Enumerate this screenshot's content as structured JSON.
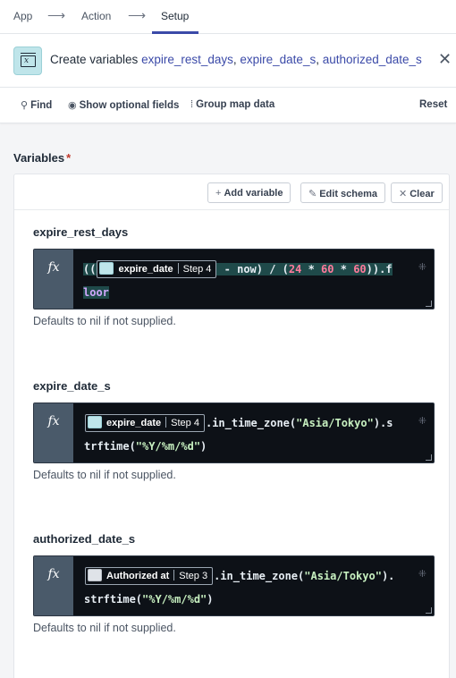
{
  "breadcrumb": {
    "steps": [
      {
        "label": "App"
      },
      {
        "label": "Action"
      },
      {
        "label": "Setup"
      }
    ],
    "active": "Setup"
  },
  "header": {
    "prefix": "Create variables ",
    "variables": [
      "expire_rest_days",
      "expire_date_s",
      "authorized_date_s"
    ],
    "separator": ", ",
    "close_icon": "close-icon"
  },
  "toolbar": {
    "find": "Find",
    "show_optional": "Show optional fields",
    "group_map": "Group map data",
    "reset": "Reset"
  },
  "section": {
    "label": "Variables",
    "required_mark": "*"
  },
  "panel_toolbar": {
    "add_variable": "Add variable",
    "edit_schema": "Edit schema",
    "clear": "Clear"
  },
  "fields": [
    {
      "name": "expire_rest_days",
      "fx": "fx",
      "pill": {
        "name": "expire_date",
        "step": "Step 4"
      },
      "code_pre": "((",
      "code_post": " - now) / (24 * 60 * 60)).f",
      "code_line2": "loor",
      "hint": "Defaults to nil if not supplied."
    },
    {
      "name": "expire_date_s",
      "fx": "fx",
      "pill": {
        "name": "expire_date",
        "step": "Step 4"
      },
      "code_post": ".in_time_zone(\"Asia/Tokyo\").s",
      "code_line2": "trftime(\"%Y/%m/%d\")",
      "hint": "Defaults to nil if not supplied."
    },
    {
      "name": "authorized_date_s",
      "fx": "fx",
      "pill": {
        "name": "Authorized at",
        "step": "Step 3"
      },
      "code_post": ".in_time_zone(\"Asia/Tokyo\").",
      "code_line2": "strftime(\"%Y/%m/%d\")",
      "hint": "Defaults to nil if not supplied."
    }
  ]
}
